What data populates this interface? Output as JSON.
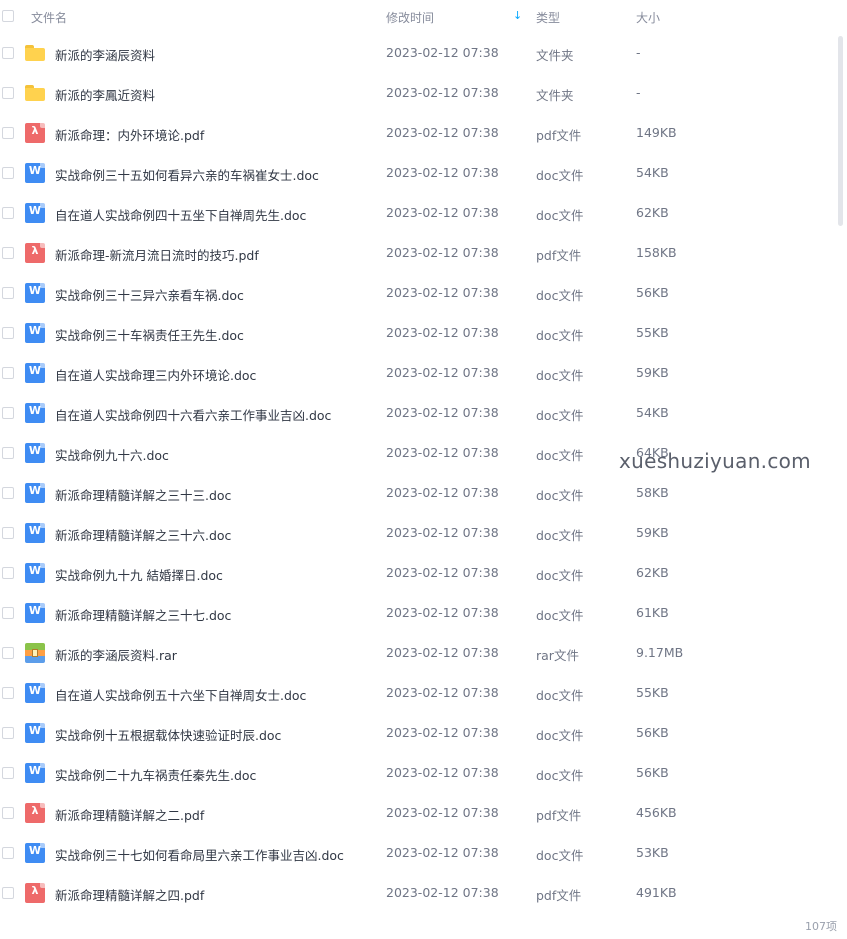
{
  "header": {
    "name_label": "文件名",
    "time_label": "修改时间",
    "type_label": "类型",
    "size_label": "大小",
    "sort_icon": "arrow-down-icon"
  },
  "files": [
    {
      "name": "新派的李涵辰资料",
      "time": "2023-02-12 07:38",
      "type": "文件夹",
      "size": "-",
      "icon": "folder"
    },
    {
      "name": "新派的李鳳近资料",
      "time": "2023-02-12 07:38",
      "type": "文件夹",
      "size": "-",
      "icon": "folder"
    },
    {
      "name": "新派命理：内外环境论.pdf",
      "time": "2023-02-12 07:38",
      "type": "pdf文件",
      "size": "149KB",
      "icon": "pdf"
    },
    {
      "name": "实战命例三十五如何看异六亲的车祸崔女士.doc",
      "time": "2023-02-12 07:38",
      "type": "doc文件",
      "size": "54KB",
      "icon": "doc"
    },
    {
      "name": "自在道人实战命例四十五坐下自禅周先生.doc",
      "time": "2023-02-12 07:38",
      "type": "doc文件",
      "size": "62KB",
      "icon": "doc"
    },
    {
      "name": "新派命理-新流月流日流时的技巧.pdf",
      "time": "2023-02-12 07:38",
      "type": "pdf文件",
      "size": "158KB",
      "icon": "pdf"
    },
    {
      "name": "实战命例三十三异六亲看车祸.doc",
      "time": "2023-02-12 07:38",
      "type": "doc文件",
      "size": "56KB",
      "icon": "doc"
    },
    {
      "name": "实战命例三十车祸责任王先生.doc",
      "time": "2023-02-12 07:38",
      "type": "doc文件",
      "size": "55KB",
      "icon": "doc"
    },
    {
      "name": "自在道人实战命理三内外环境论.doc",
      "time": "2023-02-12 07:38",
      "type": "doc文件",
      "size": "59KB",
      "icon": "doc"
    },
    {
      "name": "自在道人实战命例四十六看六亲工作事业吉凶.doc",
      "time": "2023-02-12 07:38",
      "type": "doc文件",
      "size": "54KB",
      "icon": "doc"
    },
    {
      "name": "实战命例九十六.doc",
      "time": "2023-02-12 07:38",
      "type": "doc文件",
      "size": "64KB",
      "icon": "doc"
    },
    {
      "name": "新派命理精髓详解之三十三.doc",
      "time": "2023-02-12 07:38",
      "type": "doc文件",
      "size": "58KB",
      "icon": "doc"
    },
    {
      "name": "新派命理精髓详解之三十六.doc",
      "time": "2023-02-12 07:38",
      "type": "doc文件",
      "size": "59KB",
      "icon": "doc"
    },
    {
      "name": "实战命例九十九 結婚擇日.doc",
      "time": "2023-02-12 07:38",
      "type": "doc文件",
      "size": "62KB",
      "icon": "doc"
    },
    {
      "name": "新派命理精髓详解之三十七.doc",
      "time": "2023-02-12 07:38",
      "type": "doc文件",
      "size": "61KB",
      "icon": "doc"
    },
    {
      "name": "新派的李涵辰资料.rar",
      "time": "2023-02-12 07:38",
      "type": "rar文件",
      "size": "9.17MB",
      "icon": "rar"
    },
    {
      "name": "自在道人实战命例五十六坐下自禅周女士.doc",
      "time": "2023-02-12 07:38",
      "type": "doc文件",
      "size": "55KB",
      "icon": "doc"
    },
    {
      "name": "实战命例十五根据载体快速验证时辰.doc",
      "time": "2023-02-12 07:38",
      "type": "doc文件",
      "size": "56KB",
      "icon": "doc"
    },
    {
      "name": "实战命例二十九车祸责任秦先生.doc",
      "time": "2023-02-12 07:38",
      "type": "doc文件",
      "size": "56KB",
      "icon": "doc"
    },
    {
      "name": "新派命理精髓详解之二.pdf",
      "time": "2023-02-12 07:38",
      "type": "pdf文件",
      "size": "456KB",
      "icon": "pdf"
    },
    {
      "name": "实战命例三十七如何看命局里六亲工作事业吉凶.doc",
      "time": "2023-02-12 07:38",
      "type": "doc文件",
      "size": "53KB",
      "icon": "doc"
    },
    {
      "name": "新派命理精髓详解之四.pdf",
      "time": "2023-02-12 07:38",
      "type": "pdf文件",
      "size": "491KB",
      "icon": "pdf"
    }
  ],
  "watermark": "xueshuziyuan.com",
  "item_count": "107项"
}
